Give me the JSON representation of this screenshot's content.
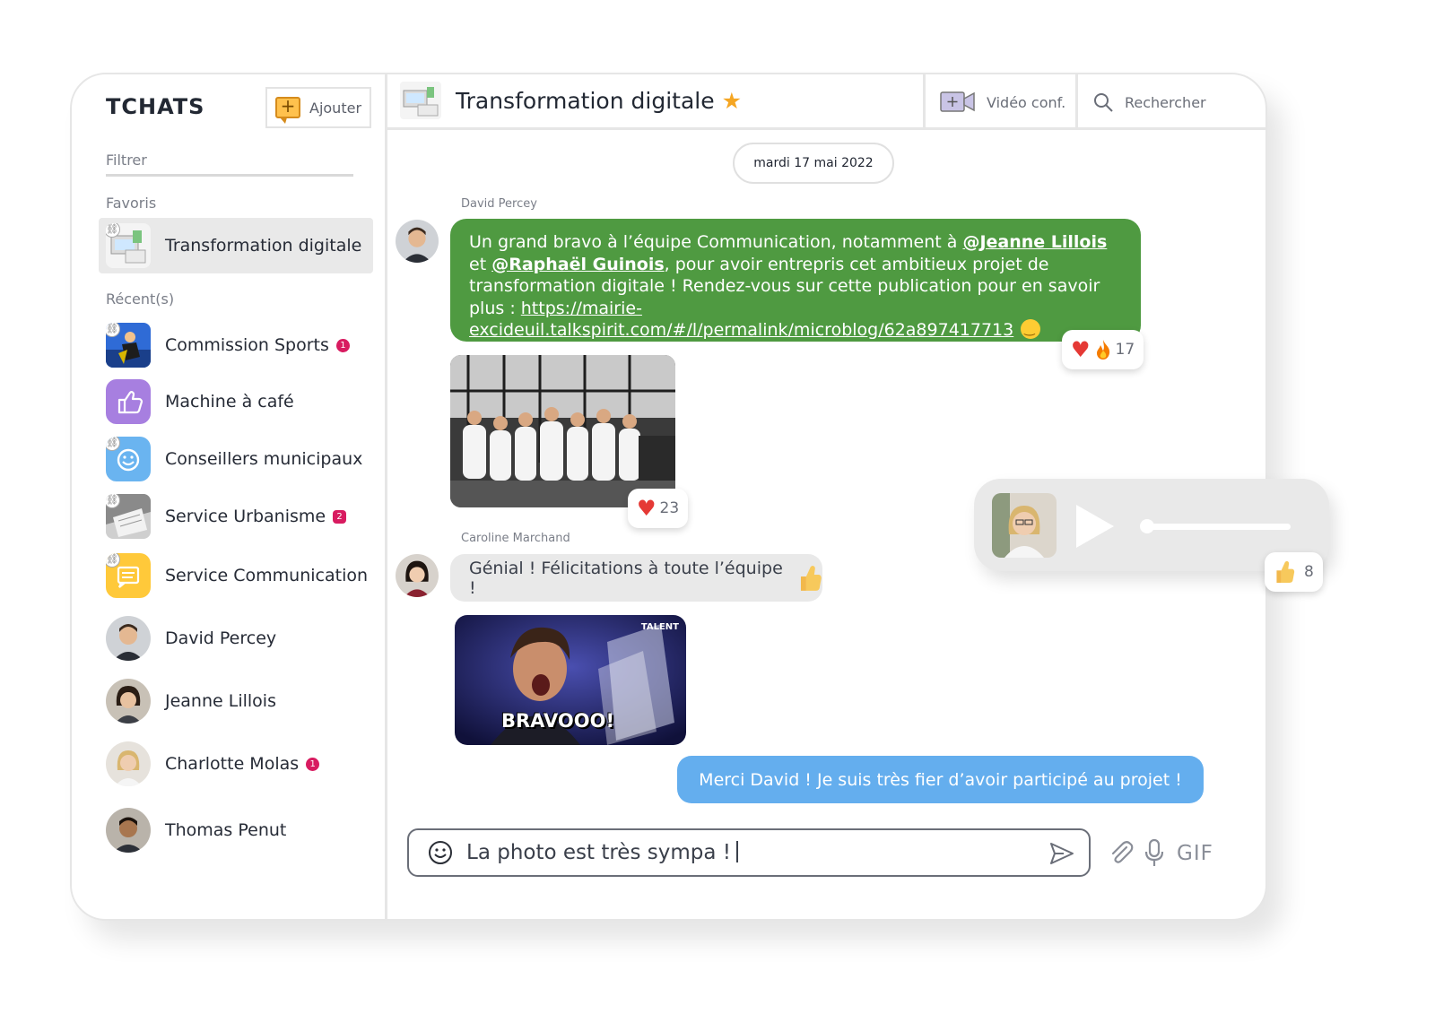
{
  "sidebar": {
    "title": "TCHATS",
    "add_label": "Ajouter",
    "filter_placeholder": "Filtrer",
    "favorites_label": "Favoris",
    "recent_label": "Récent(s)",
    "favorites": [
      {
        "name": "Transformation digitale"
      }
    ],
    "recent": [
      {
        "name": "Commission Sports",
        "badge": "1"
      },
      {
        "name": "Machine à café"
      },
      {
        "name": "Conseillers municipaux"
      },
      {
        "name": "Service Urbanisme",
        "badge": "2"
      },
      {
        "name": "Service Communication"
      },
      {
        "name": "David Percey"
      },
      {
        "name": "Jeanne Lillois"
      },
      {
        "name": "Charlotte Molas",
        "badge": "1"
      },
      {
        "name": "Thomas Penut"
      }
    ]
  },
  "header": {
    "title": "Transformation digitale",
    "video_label": "Vidéo conf.",
    "search_label": "Rechercher"
  },
  "conversation": {
    "date": "mardi 17 mai 2022",
    "messages": [
      {
        "author": "David Percey",
        "text_parts": {
          "p1": "Un grand bravo à l’équipe Communication, notamment à ",
          "m1": "@Jeanne Lillois",
          "p2": " et ",
          "m2": "@Raphaël Guinois",
          "p3": ", pour avoir entrepris cet ambitieux projet de transformation digitale ! Rendez-vous sur cette publication pour en savoir plus : ",
          "url": "https://mairie-excideuil.talkspirit.com/#/l/permalink/microblog/62a897417713"
        },
        "reaction_count": "17"
      },
      {
        "type": "image",
        "reaction_count": "23"
      },
      {
        "author": "Caroline Marchand",
        "text": "Génial ! Félicitations à toute l’équipe !"
      },
      {
        "type": "gif",
        "caption": "BRAVOOO!",
        "badge": "TALENT"
      },
      {
        "text": "Merci David ! Je suis très fier d’avoir participé au projet !"
      }
    ]
  },
  "composer": {
    "value": "La photo est très sympa !",
    "gif_label": "GIF"
  },
  "voice_card": {
    "reaction_count": "8",
    "progress": 0
  },
  "colors": {
    "accent_green": "#4f9a41",
    "accent_blue": "#64aeee",
    "badge_red": "#d81b60",
    "star": "#f5a623"
  }
}
